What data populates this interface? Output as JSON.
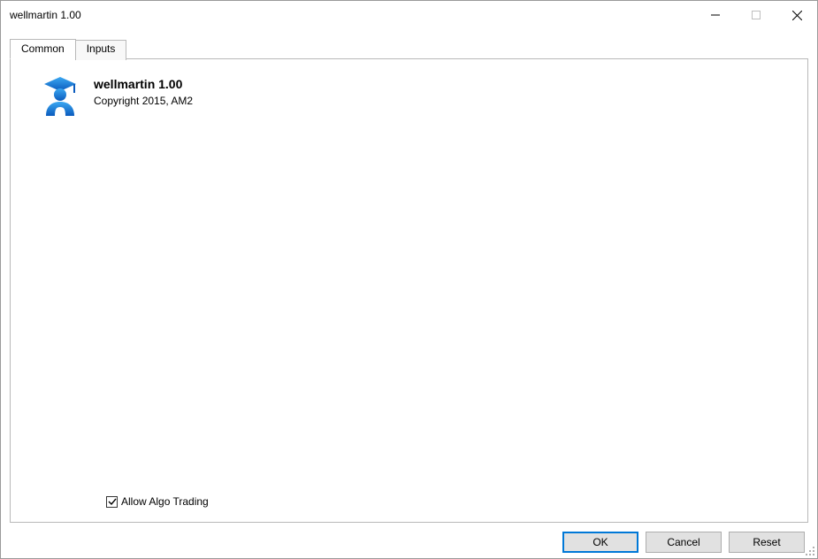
{
  "window": {
    "title": "wellmartin 1.00"
  },
  "tabs": {
    "common": "Common",
    "inputs": "Inputs"
  },
  "ea": {
    "name": "wellmartin 1.00",
    "copyright": "Copyright 2015, AM2"
  },
  "options": {
    "allow_algo_label": "Allow Algo Trading",
    "allow_algo_checked": true
  },
  "buttons": {
    "ok": "OK",
    "cancel": "Cancel",
    "reset": "Reset"
  }
}
